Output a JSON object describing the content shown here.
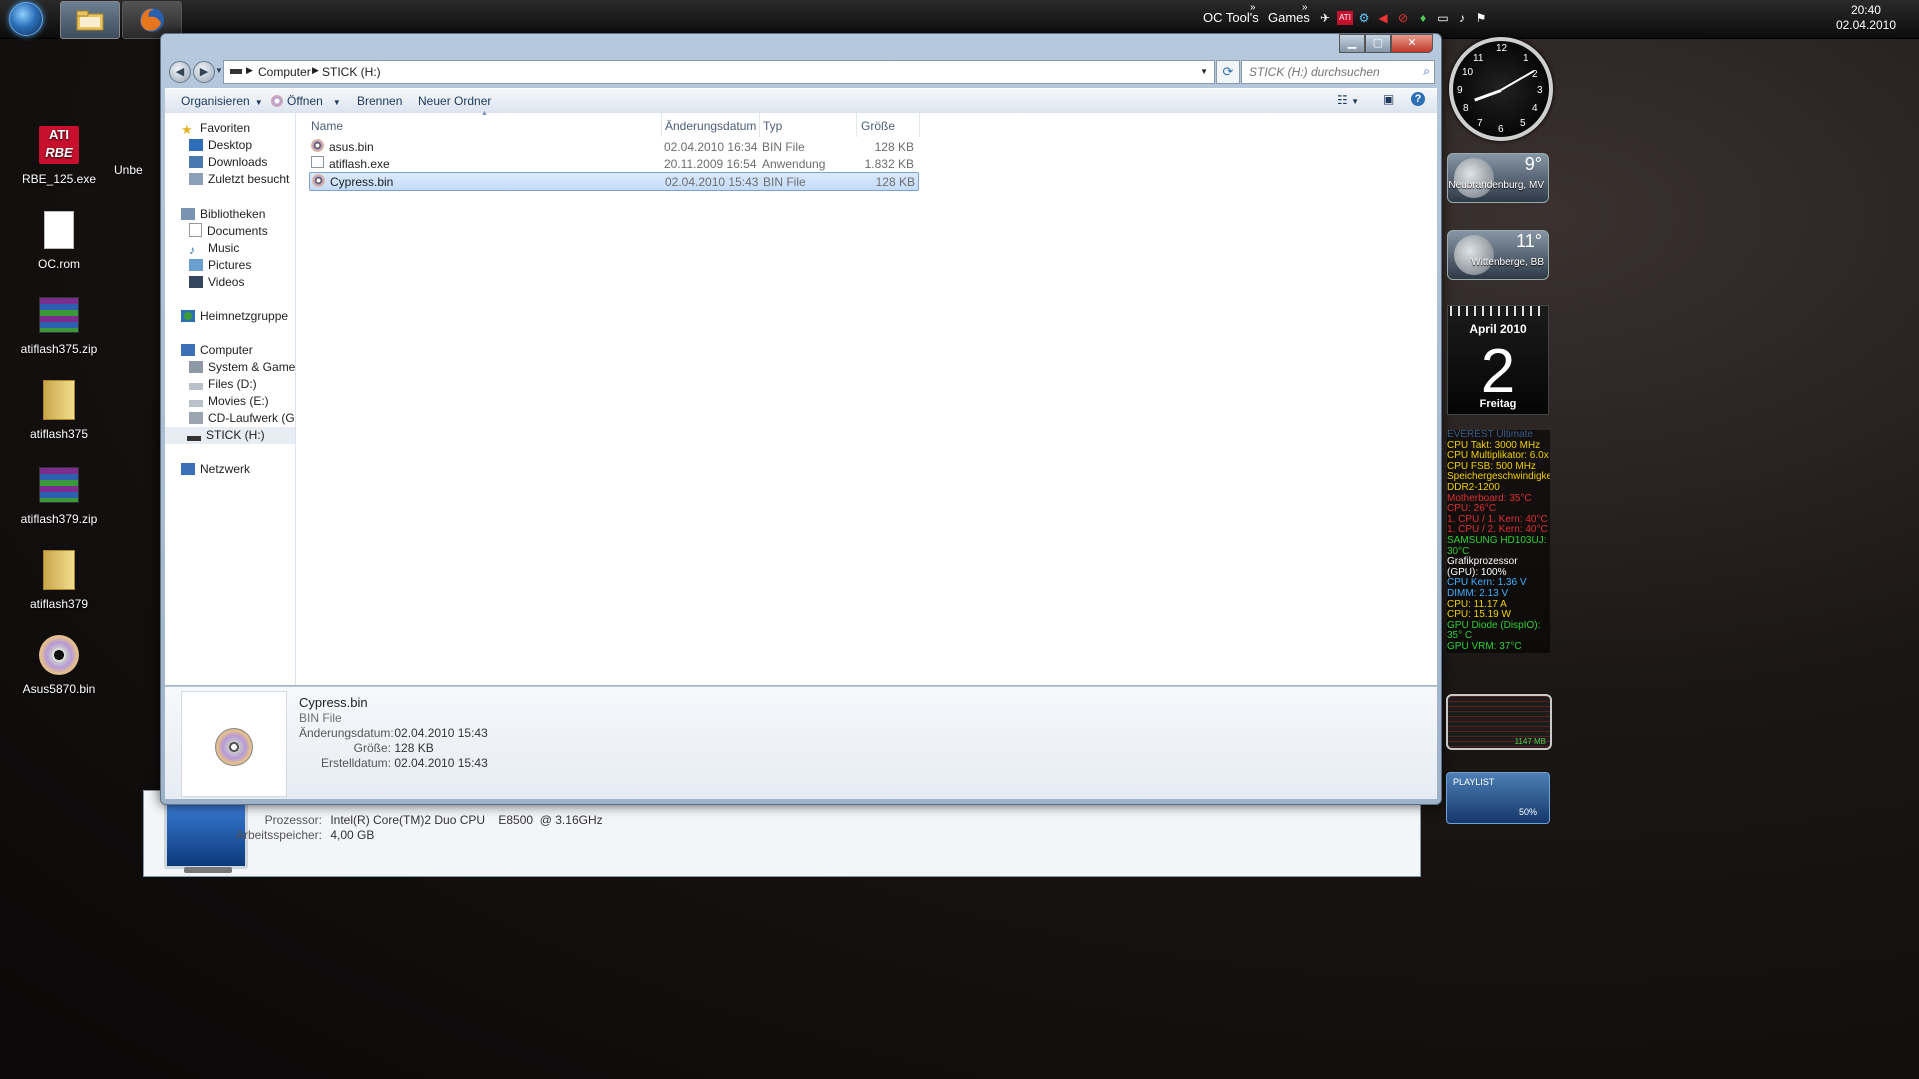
{
  "taskbar": {
    "links": [
      "OC Tool's",
      "Games"
    ],
    "clock_time": "20:40",
    "clock_date": "02.04.2010"
  },
  "desktop_icons": [
    {
      "label": "RBE_125.exe",
      "icon": "ati-rbe-icon"
    },
    {
      "label": "OC.rom",
      "icon": "file-icon"
    },
    {
      "label": "atiflash375.zip",
      "icon": "winrar-icon"
    },
    {
      "label": "atiflash375",
      "icon": "folder-icon"
    },
    {
      "label": "atiflash379.zip",
      "icon": "winrar-icon"
    },
    {
      "label": "atiflash379",
      "icon": "folder-icon"
    },
    {
      "label": "Asus5870.bin",
      "icon": "disc-icon"
    }
  ],
  "partial_desktop_label": "Unbe",
  "explorer": {
    "breadcrumb": [
      "Computer",
      "STICK (H:)"
    ],
    "search_placeholder": "STICK (H:) durchsuchen",
    "toolbar": {
      "organize": "Organisieren",
      "open": "Öffnen",
      "burn": "Brennen",
      "new_folder": "Neuer Ordner"
    },
    "nav": {
      "favorites": "Favoriten",
      "favorites_items": [
        "Desktop",
        "Downloads",
        "Zuletzt besucht"
      ],
      "libraries": "Bibliotheken",
      "libraries_items": [
        "Documents",
        "Music",
        "Pictures",
        "Videos"
      ],
      "homegroup": "Heimnetzgruppe",
      "computer": "Computer",
      "computer_items": [
        "System & Games (C",
        "Files (D:)",
        "Movies (E:)",
        "CD-Laufwerk (G:)",
        "STICK (H:)"
      ],
      "network": "Netzwerk"
    },
    "columns": [
      "Name",
      "Änderungsdatum",
      "Typ",
      "Größe"
    ],
    "files": [
      {
        "name": "asus.bin",
        "date": "02.04.2010 16:34",
        "type": "BIN File",
        "size": "128 KB",
        "icon": "disc-icon"
      },
      {
        "name": "atiflash.exe",
        "date": "20.11.2009 16:54",
        "type": "Anwendung",
        "size": "1.832 KB",
        "icon": "application-icon"
      },
      {
        "name": "Cypress.bin",
        "date": "02.04.2010 15:43",
        "type": "BIN File",
        "size": "128 KB",
        "icon": "disc-icon",
        "selected": true
      }
    ],
    "details": {
      "name": "Cypress.bin",
      "type": "BIN File",
      "modified_label": "Änderungsdatum:",
      "modified": "02.04.2010 15:43",
      "size_label": "Größe:",
      "size": "128 KB",
      "created_label": "Erstelldatum:",
      "created": "02.04.2010 15:43"
    }
  },
  "back_window": {
    "cpu_label": "Prozessor:",
    "cpu": "Intel(R) Core(TM)2 Duo CPU    E8500  @ 3.16GHz",
    "ram_label": "Arbeitsspeicher:",
    "ram": "4,00 GB"
  },
  "gadgets": {
    "weather": [
      {
        "temp": "9°",
        "city": "Neubrandenburg, MV"
      },
      {
        "temp": "11°",
        "city": "Wittenberge, BB"
      }
    ],
    "calendar": {
      "month": "April 2010",
      "day": "2",
      "weekday": "Freitag"
    },
    "everest": [
      {
        "text": "EVEREST Ultimate",
        "color": "#3a5a8a"
      },
      {
        "text": "CPU Takt: 3000 MHz",
        "color": "#f0d000"
      },
      {
        "text": "CPU Multiplikator: 6.0x",
        "color": "#f0d000"
      },
      {
        "text": "CPU FSB: 500 MHz",
        "color": "#f0d000"
      },
      {
        "text": "Speichergeschwindigkeit: DDR2-1200",
        "color": "#f0d000"
      },
      {
        "text": "Motherboard: 35°C",
        "color": "#e03030"
      },
      {
        "text": "CPU: 26°C",
        "color": "#e03030"
      },
      {
        "text": "1. CPU / 1. Kern: 40°C",
        "color": "#e03030"
      },
      {
        "text": "1. CPU / 2. Kern: 40°C",
        "color": "#e03030"
      },
      {
        "text": "SAMSUNG HD103UJ: 30°C",
        "color": "#30d030"
      },
      {
        "text": "Grafikprozessor (GPU): 100%",
        "color": "#ffffff"
      },
      {
        "text": "CPU Kern: 1.36 V",
        "color": "#40b0ff"
      },
      {
        "text": "DIMM: 2.13 V",
        "color": "#40b0ff"
      },
      {
        "text": "CPU: 11.17 A",
        "color": "#f0d000"
      },
      {
        "text": "CPU: 15.19 W",
        "color": "#f0d000"
      },
      {
        "text": "GPU Diode (DispIO): 35° C",
        "color": "#30d030"
      },
      {
        "text": "GPU VRM: 37°C",
        "color": "#30d030"
      }
    ],
    "meter_text": "1147 MB",
    "playlist_title": "PLAYLIST",
    "playlist_volume": "50%"
  }
}
